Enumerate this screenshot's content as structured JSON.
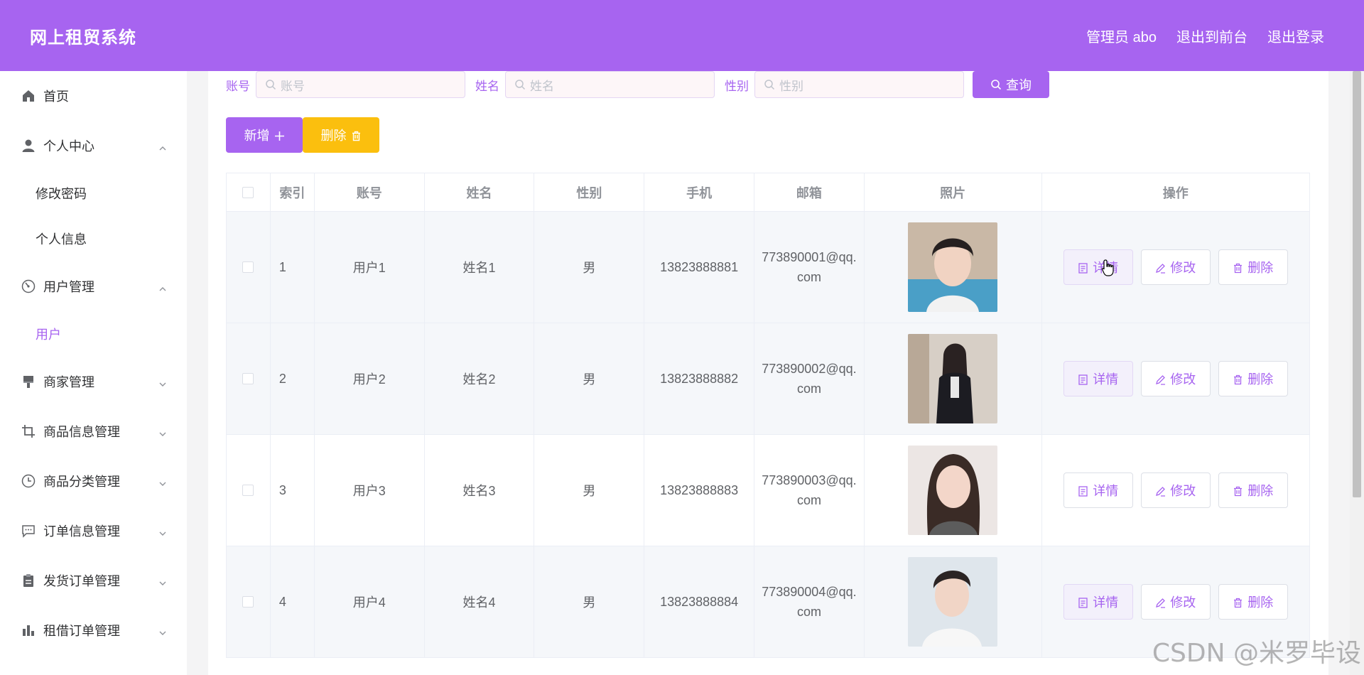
{
  "header": {
    "brand": "网上租贸系统",
    "links": [
      "管理员 abo",
      "退出到前台",
      "退出登录"
    ]
  },
  "sidebar": {
    "home": "首页",
    "personal_center": "个人中心",
    "personal_sub": [
      "修改密码",
      "个人信息"
    ],
    "user_mgmt": "用户管理",
    "user_sub": "用户",
    "groups": [
      "商家管理",
      "商品信息管理",
      "商品分类管理",
      "订单信息管理",
      "发货订单管理",
      "租借订单管理"
    ]
  },
  "search": {
    "account_label": "账号",
    "account_placeholder": "账号",
    "name_label": "姓名",
    "name_placeholder": "姓名",
    "gender_label": "性别",
    "gender_placeholder": "性别",
    "query_label": "查询"
  },
  "actions": {
    "add_label": "新增",
    "delete_label": "删除"
  },
  "table": {
    "headers": [
      "索引",
      "账号",
      "姓名",
      "性别",
      "手机",
      "邮箱",
      "照片",
      "操作"
    ],
    "rows": [
      {
        "index": "1",
        "account": "用户1",
        "name": "姓名1",
        "gender": "男",
        "phone": "13823888881",
        "email": "773890001@qq.com"
      },
      {
        "index": "2",
        "account": "用户2",
        "name": "姓名2",
        "gender": "男",
        "phone": "13823888882",
        "email": "773890002@qq.com"
      },
      {
        "index": "3",
        "account": "用户3",
        "name": "姓名3",
        "gender": "男",
        "phone": "13823888883",
        "email": "773890003@qq.com"
      },
      {
        "index": "4",
        "account": "用户4",
        "name": "姓名4",
        "gender": "男",
        "phone": "13823888884",
        "email": "773890004@qq.com"
      }
    ],
    "op_labels": {
      "detail": "详情",
      "edit": "修改",
      "delete": "删除"
    }
  },
  "watermark": "CSDN @米罗毕设",
  "colors": {
    "accent": "#a764f0",
    "warning": "#fbbf0e"
  }
}
